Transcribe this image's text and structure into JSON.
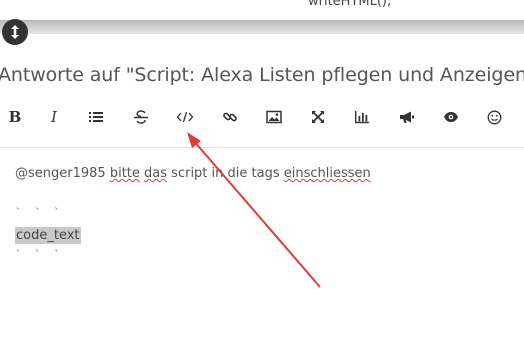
{
  "top": {
    "code_fragment": "writeHTML();"
  },
  "title": "Antworte auf \"Script: Alexa Listen pflegen und Anzeigen\"",
  "toolbar": {
    "bold": "B",
    "italic": "I"
  },
  "editor": {
    "mention": "@senger1985",
    "text": [
      {
        "t": " ",
        "s": false
      },
      {
        "t": "bitte",
        "s": true
      },
      {
        "t": " ",
        "s": false
      },
      {
        "t": "das",
        "s": true
      },
      {
        "t": " script in die tags ",
        "s": false
      },
      {
        "t": "einschliessen",
        "s": true
      }
    ],
    "fence_open": "` ` `",
    "code": "code_text",
    "fence_close": "` ` `"
  },
  "colors": {
    "annotation": "#e53935",
    "dark_button": "#333333"
  }
}
